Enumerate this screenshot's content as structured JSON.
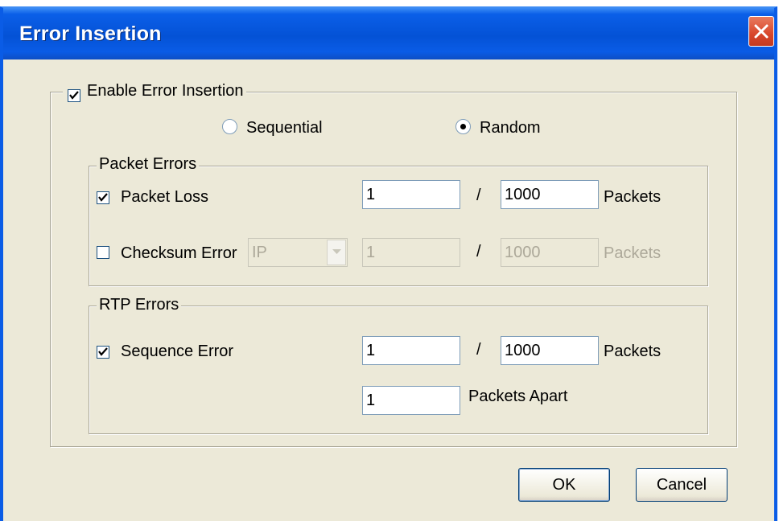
{
  "window": {
    "title": "Error Insertion"
  },
  "enable": {
    "label": "Enable Error Insertion",
    "checked": true
  },
  "mode": {
    "sequential_label": "Sequential",
    "random_label": "Random",
    "selected": "Random"
  },
  "packet_errors": {
    "legend": "Packet Errors",
    "packet_loss": {
      "label": "Packet Loss",
      "checked": true,
      "numerator": "1",
      "slash": "/",
      "denominator": "1000",
      "unit": "Packets"
    },
    "checksum": {
      "label": "Checksum Error",
      "checked": false,
      "protocol": "IP",
      "numerator": "1",
      "slash": "/",
      "denominator": "1000",
      "unit": "Packets"
    }
  },
  "rtp_errors": {
    "legend": "RTP Errors",
    "sequence": {
      "label": "Sequence Error",
      "checked": true,
      "numerator": "1",
      "slash": "/",
      "denominator": "1000",
      "unit": "Packets"
    },
    "apart": {
      "value": "1",
      "label": "Packets Apart"
    }
  },
  "buttons": {
    "ok": "OK",
    "cancel": "Cancel"
  }
}
